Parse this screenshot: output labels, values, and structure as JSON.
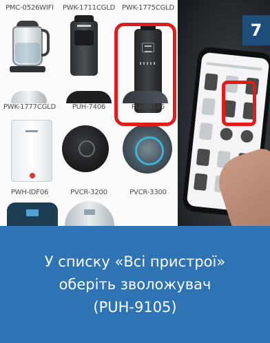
{
  "step": {
    "number": "7"
  },
  "devices": [
    {
      "label": "PMC-0526WIFI",
      "name": "kettle-glass"
    },
    {
      "label": "PWK-1711CGLD",
      "name": "humidifier-dark"
    },
    {
      "label": "PWK-1775CGLD",
      "name": "humidifier-tall"
    },
    {
      "label": "PWK-1777CGLD",
      "name": "kettle-steel"
    },
    {
      "label": "PUH-7406",
      "name": "robot-vacuum-black"
    },
    {
      "label": "PUH-9105",
      "name": "robot-vacuum-grey"
    },
    {
      "label": "PWH-IDF06",
      "name": "water-heater"
    },
    {
      "label": "PVCR-3200",
      "name": "robot-vacuum"
    },
    {
      "label": "PVCR-3300",
      "name": "robot-vacuum-blue"
    }
  ],
  "selected_device": "PUH-9105",
  "caption": {
    "line1": "У списку «Всі пристрої»",
    "line2": "оберіть зволожувач",
    "line3": "(PUH-9105)"
  },
  "colors": {
    "caption_background": "#2e74b5",
    "badge_background": "#1f4d7a",
    "highlight": "#e01d1d"
  }
}
